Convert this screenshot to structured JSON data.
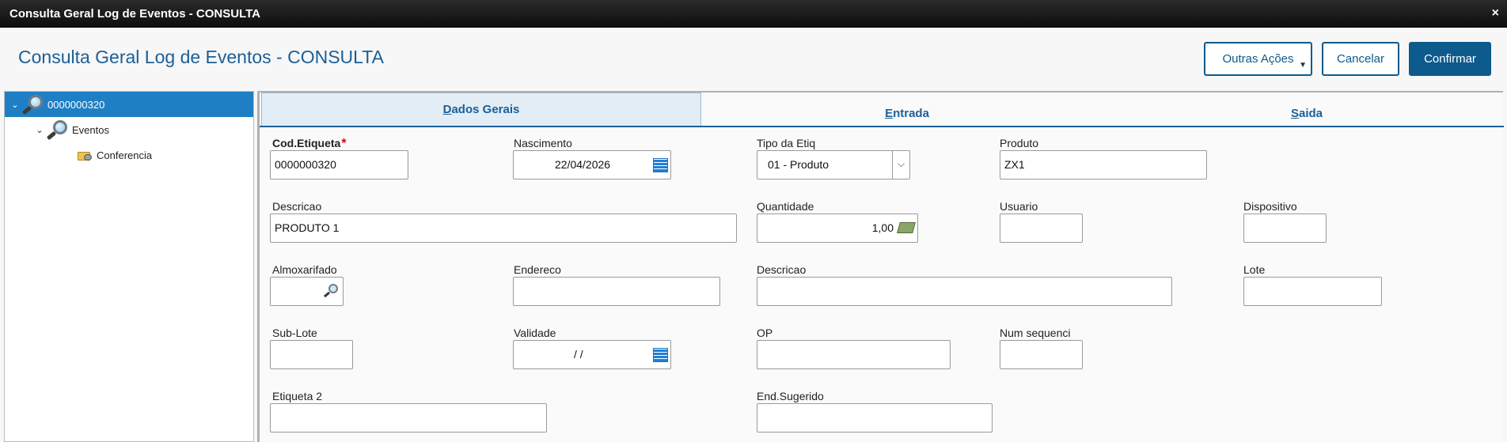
{
  "window": {
    "title": "Consulta Geral Log de Eventos - CONSULTA",
    "close_label": "×"
  },
  "header": {
    "title": "Consulta Geral Log de Eventos - CONSULTA",
    "buttons": {
      "outras_acoes": "Outras Ações",
      "cancelar": "Cancelar",
      "confirmar": "Confirmar"
    }
  },
  "tree": {
    "root": "0000000320",
    "child": "Eventos",
    "grandchild": "Conferencia"
  },
  "tabs": [
    {
      "label": "Dados Gerais",
      "accel": "D",
      "rest": "ados Gerais"
    },
    {
      "label": "Entrada",
      "accel": "E",
      "rest": "ntrada"
    },
    {
      "label": "Saida",
      "accel": "S",
      "rest": "aida"
    }
  ],
  "form": {
    "cod_etiqueta": {
      "label": "Cod.Etiqueta",
      "required": "*",
      "value": "0000000320"
    },
    "nascimento": {
      "label": "Nascimento",
      "value": "22/04/2026"
    },
    "tipo_etiq": {
      "label": "Tipo da Etiq",
      "value": "01 - Produto"
    },
    "produto": {
      "label": "Produto",
      "value": "ZX1"
    },
    "descricao": {
      "label": "Descricao",
      "value": "PRODUTO 1"
    },
    "quantidade": {
      "label": "Quantidade",
      "value": "1,00"
    },
    "usuario": {
      "label": "Usuario",
      "value": ""
    },
    "dispositivo": {
      "label": "Dispositivo",
      "value": ""
    },
    "almoxarifado": {
      "label": "Almoxarifado",
      "value": ""
    },
    "endereco": {
      "label": "Endereco",
      "value": ""
    },
    "descricao2": {
      "label": "Descricao",
      "value": ""
    },
    "lote": {
      "label": "Lote",
      "value": ""
    },
    "sub_lote": {
      "label": "Sub-Lote",
      "value": ""
    },
    "validade": {
      "label": "Validade",
      "value": "/  /"
    },
    "op": {
      "label": "OP",
      "value": ""
    },
    "num_sequenci": {
      "label": "Num sequenci",
      "value": ""
    },
    "etiqueta2": {
      "label": "Etiqueta 2",
      "value": ""
    },
    "end_sugerido": {
      "label": "End.Sugerido",
      "value": ""
    }
  }
}
